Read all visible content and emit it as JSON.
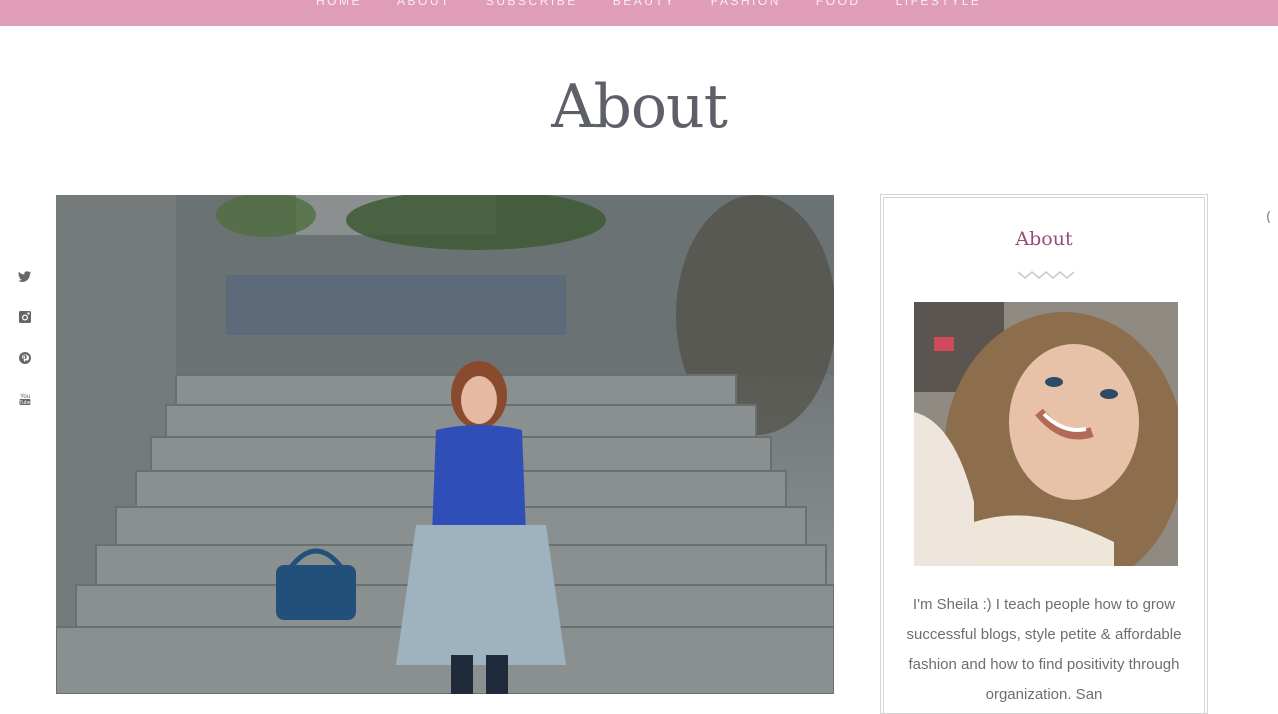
{
  "nav": {
    "items": [
      {
        "label": "HOME"
      },
      {
        "label": "ABOUT"
      },
      {
        "label": "SUBSCRIBE"
      },
      {
        "label": "BEAUTY"
      },
      {
        "label": "FASHION"
      },
      {
        "label": "FOOD"
      },
      {
        "label": "LIFESTYLE"
      }
    ],
    "background_color": "#e09db7"
  },
  "page": {
    "title": "About"
  },
  "social": {
    "icons": [
      "twitter-icon",
      "instagram-icon",
      "pinterest-icon",
      "youtube-icon"
    ]
  },
  "hero": {
    "alt": "Woman in blue blouse and metallic pleated skirt sitting on stone steps with a blue handbag"
  },
  "sidebar": {
    "widget_title": "About",
    "profile_alt": "Smiling woman with long wavy hair",
    "bio": "I'm Sheila :) I teach people how to grow successful blogs, style petite & affordable fashion and how to find positivity through organization. San",
    "accent_color": "#9a4c77"
  },
  "edge": {
    "partial_glyph": "("
  }
}
